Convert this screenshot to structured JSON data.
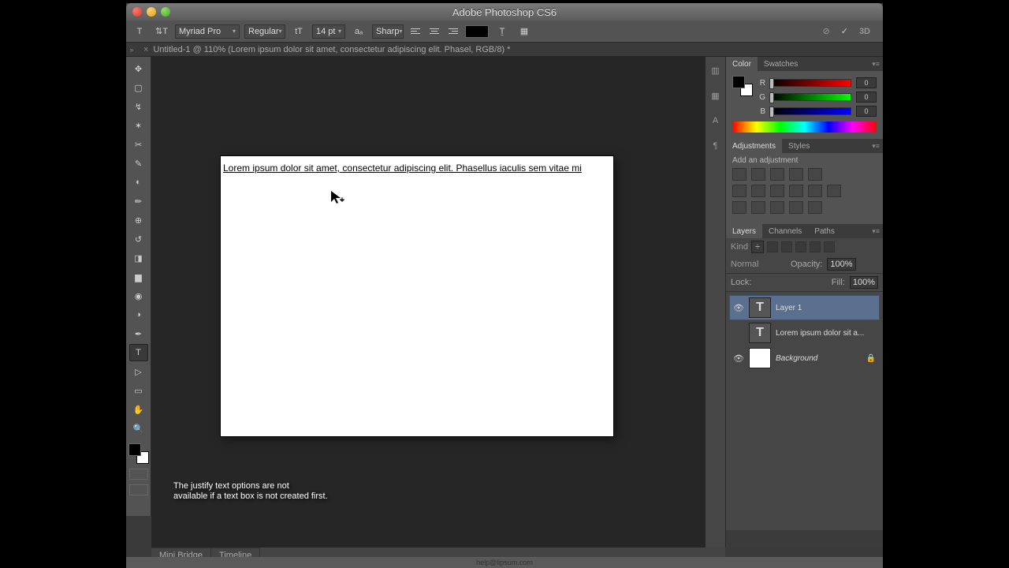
{
  "app": {
    "title": "Adobe Photoshop CS6"
  },
  "options": {
    "font": "Myriad Pro",
    "weight": "Regular",
    "size": "14 pt",
    "aa": "Sharp"
  },
  "document": {
    "tab_title": "Untitled-1 @ 110% (Lorem ipsum dolor sit amet, consectetur adipiscing elit. Phasel, RGB/8) *",
    "canvas_text": "Lorem ipsum dolor sit amet, consectetur adipiscing elit. Phasellus iaculis sem vitae mi"
  },
  "panels": {
    "color": {
      "tab_color": "Color",
      "tab_swatches": "Swatches",
      "labels": {
        "r": "R",
        "g": "G",
        "b": "B"
      },
      "values": {
        "r": "0",
        "g": "0",
        "b": "0"
      }
    },
    "adjustments": {
      "tab_adjustments": "Adjustments",
      "tab_styles": "Styles",
      "add_label": "Add an adjustment"
    },
    "layers": {
      "tab_layers": "Layers",
      "tab_channels": "Channels",
      "tab_paths": "Paths",
      "kind_label": "Kind",
      "blend_mode": "Normal",
      "opacity_label": "Opacity:",
      "opacity_value": "100%",
      "lock_label": "Lock:",
      "fill_label": "Fill:",
      "fill_value": "100%",
      "items": [
        {
          "name": "Layer 1",
          "type": "text",
          "visible": true,
          "selected": true
        },
        {
          "name": "Lorem ipsum dolor sit a...",
          "type": "text",
          "visible": false,
          "selected": false
        },
        {
          "name": "Background",
          "type": "bg",
          "visible": true,
          "selected": false,
          "locked": true
        }
      ]
    }
  },
  "statusbar": {
    "tab_minibridge": "Mini Bridge",
    "tab_timeline": "Timeline"
  },
  "caption": {
    "line1": "The justify text options are not",
    "line2": "available if a text box is not created first."
  },
  "footer": {
    "text": "help@lipsum.com"
  },
  "right_actions": {
    "threed": "3D"
  }
}
